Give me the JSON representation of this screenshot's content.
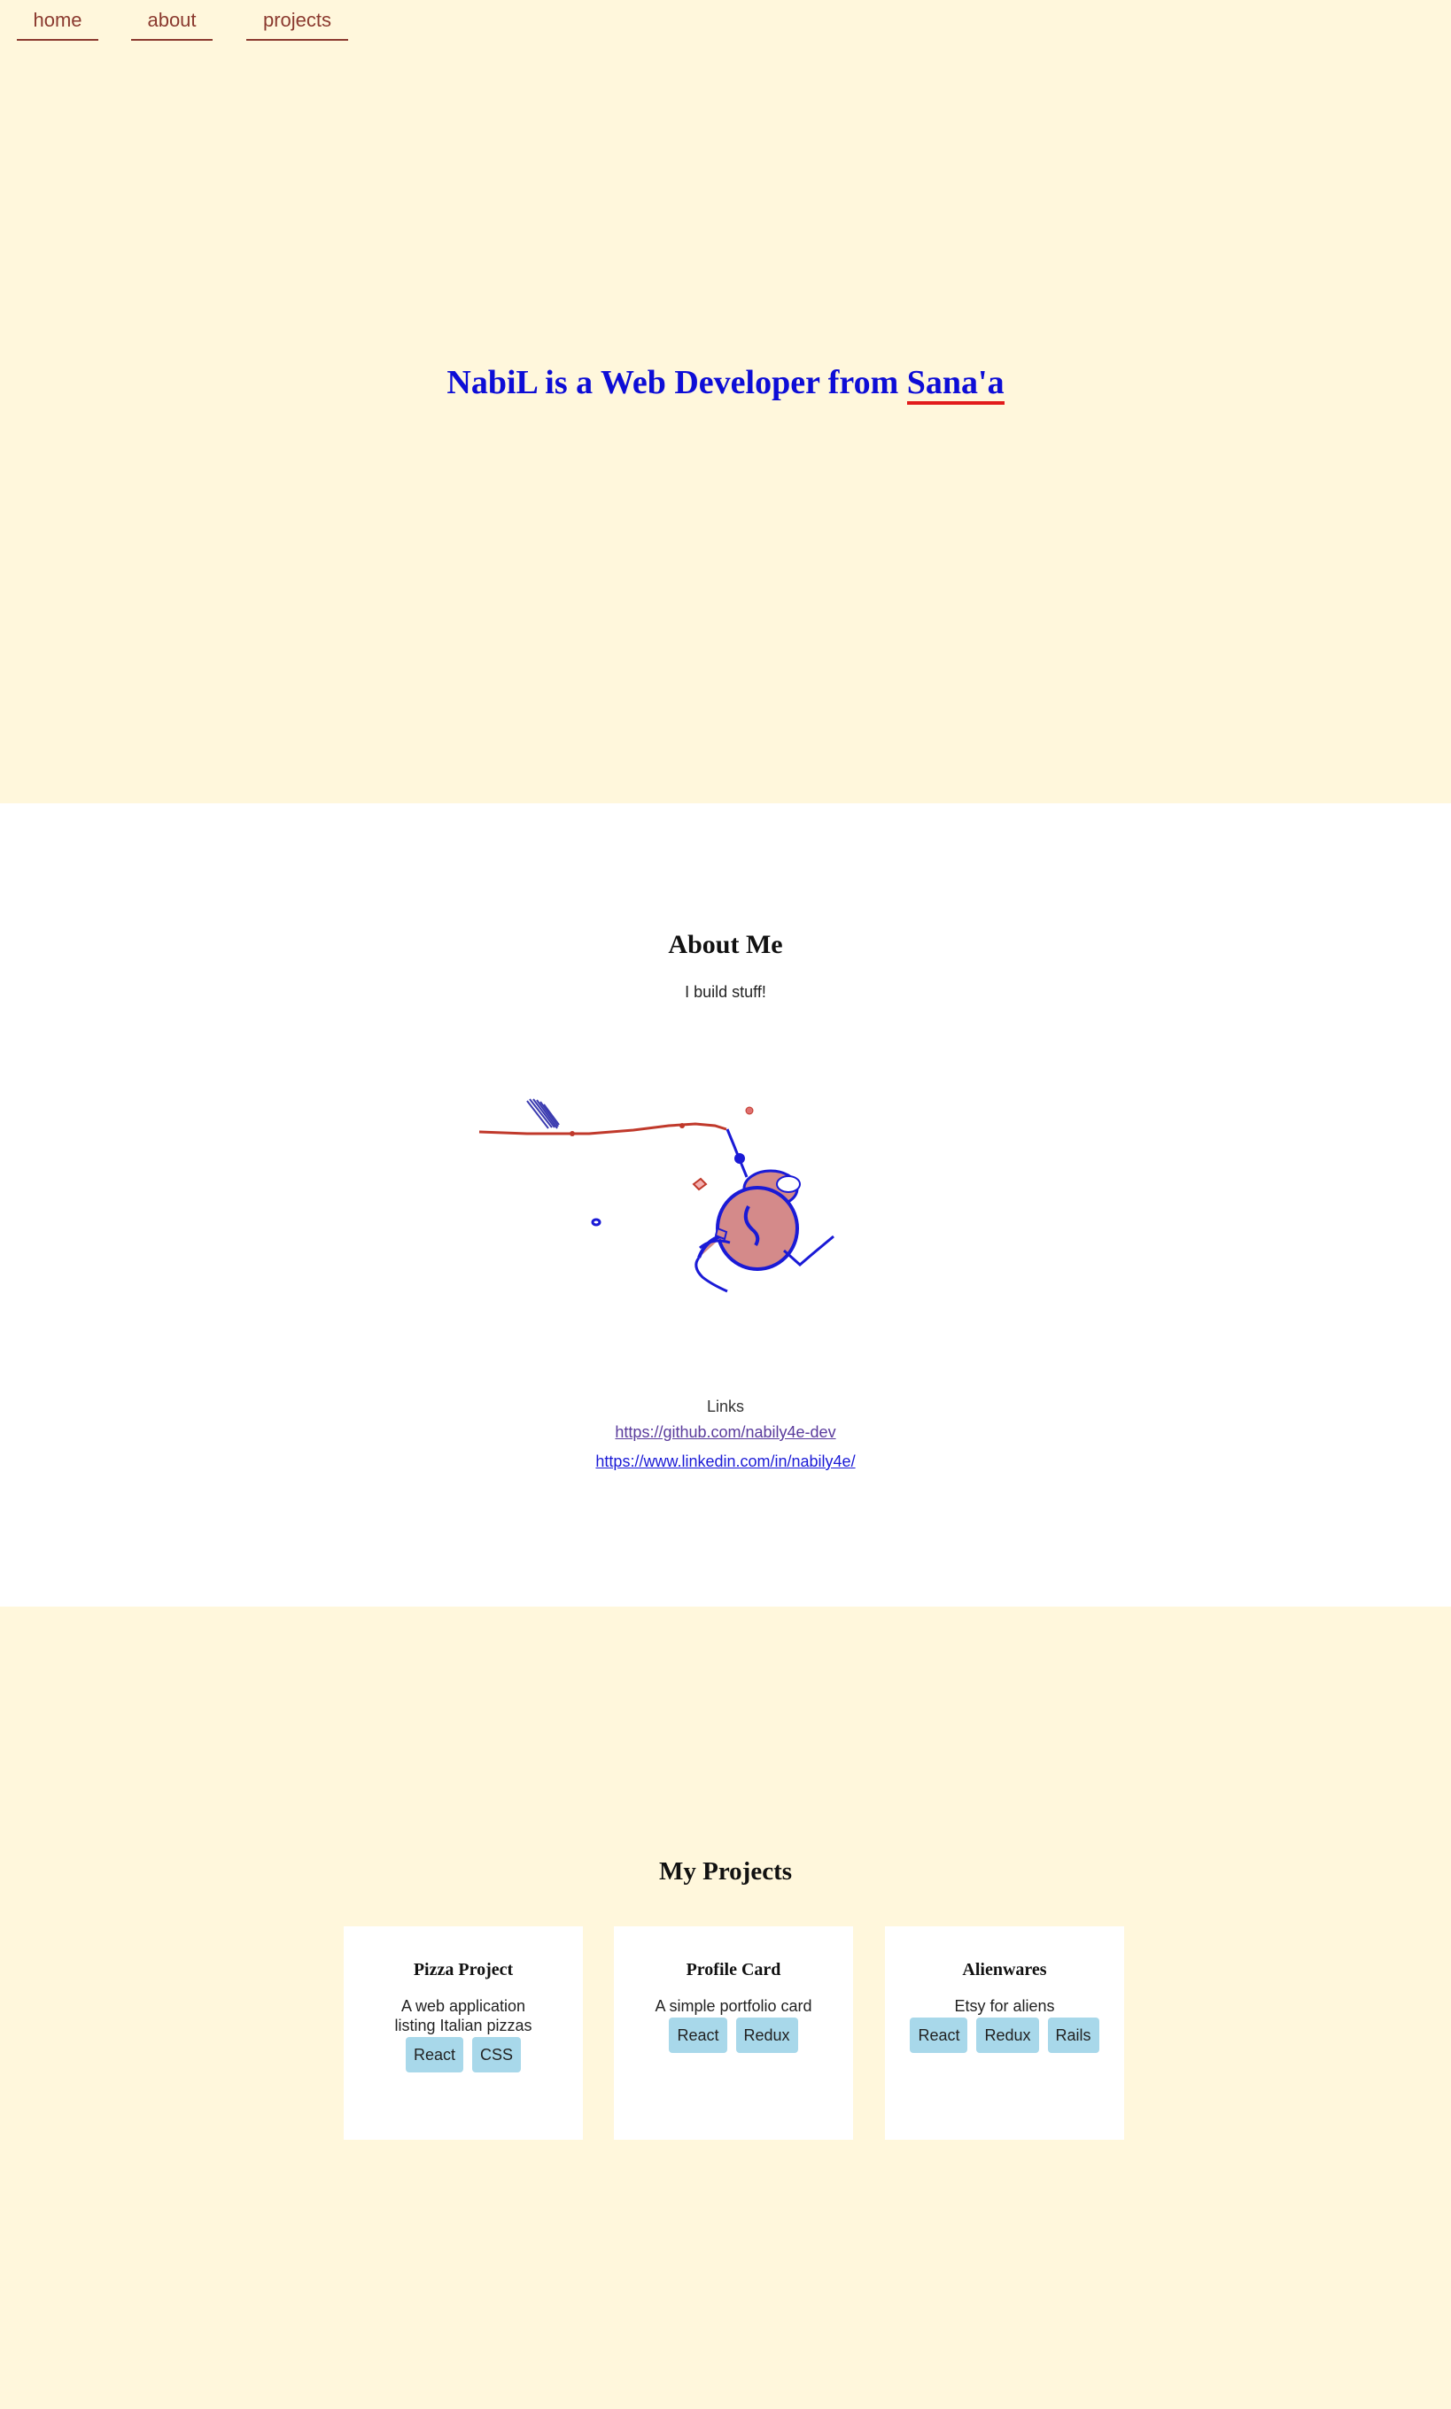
{
  "nav": {
    "home": "home",
    "about": "about",
    "projects": "projects"
  },
  "hero": {
    "title_prefix": "NabiL is a Web Developer from ",
    "city": "Sana'a"
  },
  "about": {
    "title": "About Me",
    "tagline": "I build stuff!",
    "links_title": "Links",
    "github": "https://github.com/nabily4e-dev",
    "linkedin": "https://www.linkedin.com/in/nabily4e/"
  },
  "projects": {
    "title": "My Projects",
    "items": [
      {
        "title": "Pizza Project",
        "description": "A web application listing Italian pizzas",
        "tags": [
          "React",
          "CSS"
        ]
      },
      {
        "title": "Profile Card",
        "description": "A simple portfolio card",
        "tags": [
          "React",
          "Redux"
        ]
      },
      {
        "title": "Alienwares",
        "description": "Etsy for aliens",
        "tags": [
          "React",
          "Redux",
          "Rails"
        ]
      }
    ]
  },
  "colors": {
    "cream_bg": "#fff7dc",
    "nav_text": "#8b3a2f",
    "hero_text": "#0d0dd6",
    "underline_red": "#e21b1b",
    "tag_bg": "#a8d8ea"
  }
}
